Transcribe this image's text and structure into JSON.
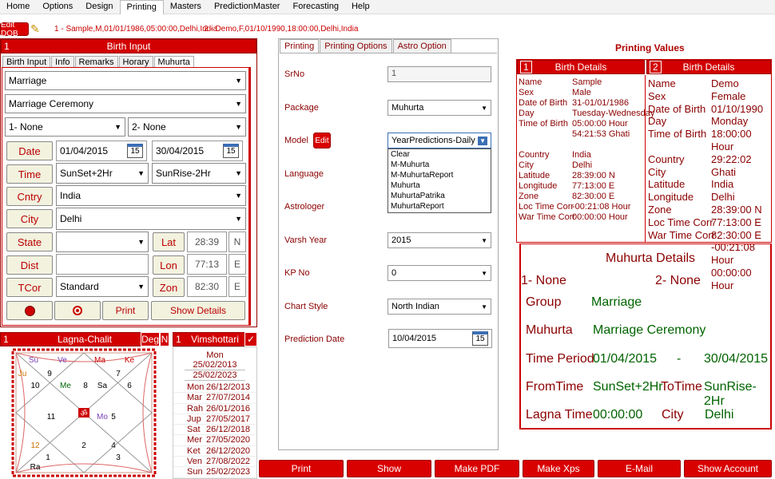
{
  "menu": [
    "Home",
    "Options",
    "Design",
    "Printing",
    "Masters",
    "PredictionMaster",
    "Forecasting",
    "Help"
  ],
  "infobar": {
    "edit_dob": "Edit DOB",
    "person1": "1 - Sample,M,01/01/1986,05:00:00,Delhi,India",
    "person2": "2 - Demo,F,01/10/1990,18:00:00,Delhi,India"
  },
  "birth_input": {
    "num": "1",
    "title": "Birth Input",
    "tabs": [
      "Birth Input",
      "Info",
      "Remarks",
      "Horary",
      "Muhurta"
    ],
    "group": "Marriage",
    "muhurta": "Marriage Ceremony",
    "sel1": "1- None",
    "sel2": "2- None",
    "date_label": "Date",
    "date_from": "01/04/2015",
    "date_to": "30/04/2015",
    "cal_icon": "15",
    "time_label": "Time",
    "time_from": "SunSet+2Hr",
    "time_to": "SunRise-2Hr",
    "country_label": "Cntry",
    "country": "India",
    "city_label": "City",
    "city": "Delhi",
    "state_label": "State",
    "state": "",
    "lat_label": "Lat",
    "lat": "28:39",
    "lat_dir": "N",
    "dist_label": "Dist",
    "lon_label": "Lon",
    "lon": "77:13",
    "lon_dir": "E",
    "tcor_label": "TCor",
    "tcor": "Standard",
    "zon_label": "Zon",
    "zon": "82:30",
    "zon_dir": "E",
    "print": "Print",
    "show_details": "Show Details"
  },
  "lagna": {
    "num": "1",
    "title": "Lagna-Chalit",
    "deg": "Deg",
    "n": "N",
    "labels": [
      {
        "t": "Su",
        "c": "#7a3fb5"
      },
      {
        "t": "Ve",
        "c": "#7a3fb5"
      },
      {
        "t": "Ma",
        "c": "#c00"
      },
      {
        "t": "Ke",
        "c": "#c00"
      },
      {
        "t": "Ju",
        "c": "#d07000"
      },
      {
        "t": "9",
        "c": "#000"
      },
      {
        "t": "7",
        "c": "#000"
      },
      {
        "t": "10",
        "c": "#000"
      },
      {
        "t": "Me",
        "c": "#006400"
      },
      {
        "t": "8",
        "c": "#000"
      },
      {
        "t": "Sa",
        "c": "#000"
      },
      {
        "t": "6",
        "c": "#000"
      },
      {
        "t": "11",
        "c": "#000"
      },
      {
        "t": "5",
        "c": "#000"
      },
      {
        "t": "Mo",
        "c": "#7a3fb5"
      },
      {
        "t": "2",
        "c": "#000"
      },
      {
        "t": "12",
        "c": "#d07000"
      },
      {
        "t": "4",
        "c": "#000"
      },
      {
        "t": "1",
        "c": "#000"
      },
      {
        "t": "3",
        "c": "#000"
      },
      {
        "t": "Ra",
        "c": "#000"
      }
    ]
  },
  "vimshottari": {
    "num": "1",
    "title": "Vimshottari",
    "check": "✓",
    "head": "Mon",
    "range1": "25/02/2013",
    "range2": "25/02/2023",
    "rows": [
      [
        "Mon",
        "26/12/2013"
      ],
      [
        "Mar",
        "27/07/2014"
      ],
      [
        "Rah",
        "26/01/2016"
      ],
      [
        "Jup",
        "27/05/2017"
      ],
      [
        "Sat",
        "26/12/2018"
      ],
      [
        "Mer",
        "27/05/2020"
      ],
      [
        "Ket",
        "26/12/2020"
      ],
      [
        "Ven",
        "27/08/2022"
      ],
      [
        "Sun",
        "25/02/2023"
      ]
    ]
  },
  "printing": {
    "tabs": [
      "Printing",
      "Printing Options",
      "Astro Option"
    ],
    "srno_label": "SrNo",
    "srno": "1",
    "package_label": "Package",
    "package": "Muhurta",
    "model_label": "Model",
    "edit": "Edit",
    "model": "YearPredictions-Daily",
    "model_options": [
      "Clear",
      "M-Muhurta",
      "M-MuhurtaReport",
      "Muhurta",
      "MuhurtaPatrika",
      "MuhurtaReport"
    ],
    "language_label": "Language",
    "astrologer_label": "Astrologer",
    "varsh_label": "Varsh Year",
    "varsh": "2015",
    "kp_label": "KP No",
    "kp": "0",
    "style_label": "Chart Style",
    "style": "North Indian",
    "pdate_label": "Prediction Date",
    "pdate": "10/04/2015"
  },
  "values": {
    "title": "Printing Values",
    "left": {
      "num": "1",
      "title": "Birth Details",
      "keys": [
        "Name",
        "Sex",
        "Date of Birth",
        "Day",
        "Time of Birth",
        "",
        "",
        "Country",
        "City",
        "Latitude",
        "Longitude",
        "Zone",
        "Loc Time Corr",
        "War Time Corr"
      ],
      "vals": [
        "Sample",
        "Male",
        "31-01/01/1986",
        "Tuesday-Wednesday",
        "05:00:00 Hour",
        "54:21:53 Ghati",
        "",
        "India",
        "Delhi",
        "28:39:00 N",
        "77:13:00 E",
        "82:30:00 E",
        "-00:21:08 Hour",
        "00:00:00 Hour"
      ]
    },
    "right": {
      "num": "2",
      "title": "Birth Details",
      "keys": [
        "Name",
        "Sex",
        "Date of Birth",
        "Day",
        "Time of Birth",
        "",
        "Country",
        "City",
        "Latitude",
        "Longitude",
        "Zone",
        "Loc Time Corr",
        "War Time Corr"
      ],
      "vals": [
        "Demo",
        "Female",
        "01/10/1990",
        "Monday",
        "18:00:00 Hour",
        "29:22:02 Ghati",
        "India",
        "Delhi",
        "28:39:00 N",
        "77:13:00 E",
        "82:30:00 E",
        "-00:21:08 Hour",
        "00:00:00 Hour"
      ]
    }
  },
  "muhurta": {
    "title": "Muhurta Details",
    "p1": "1- None",
    "p2": "2- None",
    "group_k": "Group",
    "group_v": "Marriage",
    "muh_k": "Muhurta",
    "muh_v": "Marriage Ceremony",
    "tp_k": "Time Period",
    "tp_from": "01/04/2015",
    "tp_dash": "-",
    "tp_to": "30/04/2015",
    "ft_k": "FromTime",
    "ft_v": "SunSet+2Hr",
    "tt_k": "ToTime",
    "tt_v": "SunRise-2Hr",
    "lt_k": "Lagna Time",
    "lt_v": "00:00:00",
    "city_k": "City",
    "city_v": "Delhi"
  },
  "buttons": [
    "Print",
    "Show",
    "Make PDF",
    "Make Xps",
    "E-Mail",
    "Show Account"
  ]
}
